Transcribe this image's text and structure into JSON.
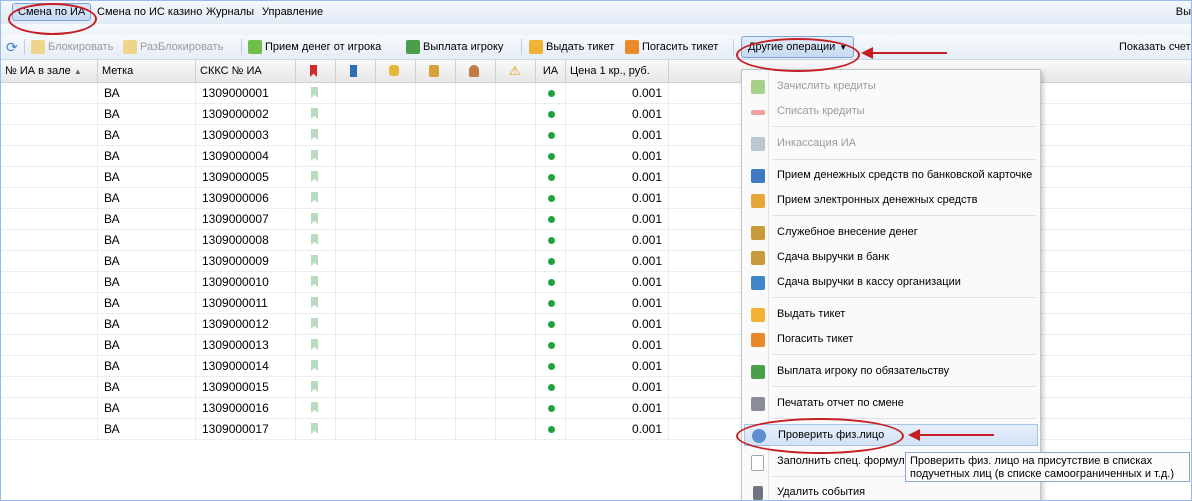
{
  "menubar": {
    "items": [
      "Смена по ИА",
      "Смена по ИС казино",
      "Журналы",
      "Управление"
    ],
    "right_text": "Вы"
  },
  "toolbar": {
    "block": "Блокировать",
    "unblock": "РазБлокировать",
    "accept_money": "Прием денег от игрока",
    "payout": "Выплата игроку",
    "issue_ticket": "Выдать тикет",
    "redeem_ticket": "Погасить тикет",
    "other_ops": "Другие операции",
    "show_counters": "Показать счетч"
  },
  "grid": {
    "headers": [
      "№ ИА в зале",
      "Метка",
      "СККС № ИА",
      "ИА",
      "Цена 1 кр., руб."
    ],
    "rows": [
      {
        "label": "ВА",
        "sccs": "1309000001",
        "price": "0.001"
      },
      {
        "label": "ВА",
        "sccs": "1309000002",
        "price": "0.001"
      },
      {
        "label": "ВА",
        "sccs": "1309000003",
        "price": "0.001"
      },
      {
        "label": "ВА",
        "sccs": "1309000004",
        "price": "0.001"
      },
      {
        "label": "ВА",
        "sccs": "1309000005",
        "price": "0.001"
      },
      {
        "label": "ВА",
        "sccs": "1309000006",
        "price": "0.001"
      },
      {
        "label": "ВА",
        "sccs": "1309000007",
        "price": "0.001"
      },
      {
        "label": "ВА",
        "sccs": "1309000008",
        "price": "0.001"
      },
      {
        "label": "ВА",
        "sccs": "1309000009",
        "price": "0.001"
      },
      {
        "label": "ВА",
        "sccs": "1309000010",
        "price": "0.001"
      },
      {
        "label": "ВА",
        "sccs": "1309000011",
        "price": "0.001"
      },
      {
        "label": "ВА",
        "sccs": "1309000012",
        "price": "0.001"
      },
      {
        "label": "ВА",
        "sccs": "1309000013",
        "price": "0.001"
      },
      {
        "label": "ВА",
        "sccs": "1309000014",
        "price": "0.001"
      },
      {
        "label": "ВА",
        "sccs": "1309000015",
        "price": "0.001"
      },
      {
        "label": "ВА",
        "sccs": "1309000016",
        "price": "0.001"
      },
      {
        "label": "ВА",
        "sccs": "1309000017",
        "price": "0.001"
      }
    ]
  },
  "menu": {
    "items": [
      {
        "label": "Зачислить кредиты",
        "disabled": true
      },
      {
        "label": "Списать кредиты",
        "disabled": true
      },
      {
        "label": "Инкассация ИА",
        "disabled": true
      },
      {
        "label": "Прием денежных средств по банковской карточке",
        "disabled": false
      },
      {
        "label": "Прием электронных денежных средств",
        "disabled": false
      },
      {
        "label": "Служебное внесение денег",
        "disabled": false
      },
      {
        "label": "Сдача выручки в банк",
        "disabled": false
      },
      {
        "label": "Сдача выручки в кассу организации",
        "disabled": false
      },
      {
        "label": "Выдать тикет",
        "disabled": false
      },
      {
        "label": "Погасить тикет",
        "disabled": false
      },
      {
        "label": "Выплата игроку по обязательству",
        "disabled": false
      },
      {
        "label": "Печатать отчет по смене",
        "disabled": false
      },
      {
        "label": "Проверить физ.лицо",
        "disabled": false
      },
      {
        "label": "Заполнить спец. формул",
        "disabled": false
      },
      {
        "label": "Удалить события",
        "disabled": false
      }
    ]
  },
  "tooltip": {
    "line1": "Проверить физ. лицо на присутствие в списках",
    "line2": "подучетных лиц (в списке самоограниченных и т.д.)"
  },
  "colors": {
    "annotation_red": "#c51f24",
    "status_green": "#1ea33d",
    "bookmark_green": "#b9dcc0"
  }
}
